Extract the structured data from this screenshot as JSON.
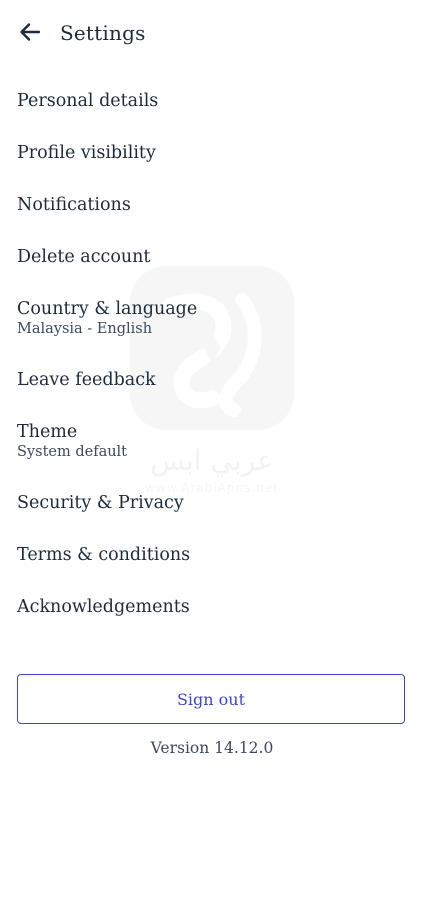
{
  "header": {
    "title": "Settings",
    "back_icon": "arrow-left-icon"
  },
  "menu": {
    "items": [
      {
        "label": "Personal details"
      },
      {
        "label": "Profile visibility"
      },
      {
        "label": "Notifications"
      },
      {
        "label": "Delete account"
      },
      {
        "label": "Country & language",
        "sub": "Malaysia - English"
      },
      {
        "label": "Leave feedback"
      },
      {
        "label": "Theme",
        "sub": "System default"
      },
      {
        "label": "Security & Privacy"
      },
      {
        "label": "Terms & conditions"
      },
      {
        "label": "Acknowledgements"
      }
    ]
  },
  "footer": {
    "sign_out_label": "Sign out",
    "version": "Version 14.12.0"
  },
  "watermark": {
    "text_arabic": "عربي ابس",
    "url": "www.ArabiApps.net"
  },
  "colors": {
    "text": "#1c2a3a",
    "accent": "#3d46c7",
    "secondary": "#3a4a5e"
  }
}
